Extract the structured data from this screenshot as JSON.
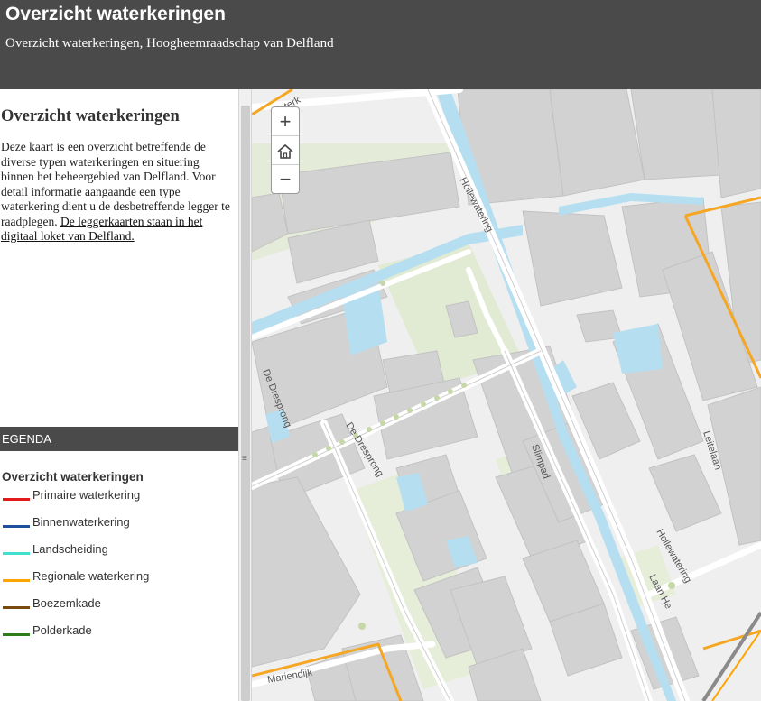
{
  "header": {
    "title": "Overzicht waterkeringen",
    "subtitle": "Overzicht waterkeringen, Hoogheemraadschap van Delfland"
  },
  "sidebar": {
    "heading": "Overzicht waterkeringen",
    "description": "Deze kaart is een overzicht betreffende de diverse typen waterkeringen en situering binnen het beheergebied van Delfland. Voor detail informatie aangaande een type waterkering dient u de desbetreffende legger te raadplegen.",
    "link_text": "De leggerkaarten staan in het digitaal loket van Delfland."
  },
  "legend": {
    "bar_label": "EGENDA",
    "title": "Overzicht waterkeringen",
    "items": [
      {
        "label": "Primaire waterkering",
        "color": "#e31a1c"
      },
      {
        "label": "Binnenwaterkering",
        "color": "#1f4e9c"
      },
      {
        "label": "Landscheiding",
        "color": "#40e0d0"
      },
      {
        "label": "Regionale waterkering",
        "color": "#ffa500"
      },
      {
        "label": "Boezemkade",
        "color": "#7a4a0e"
      },
      {
        "label": "Polderkade",
        "color": "#2e7d1a"
      }
    ]
  },
  "map": {
    "zoom_in": "+",
    "zoom_out": "−",
    "home_icon": "home-icon",
    "street_labels": {
      "hollewatering_1": "Hollewatering",
      "hollewatering_2": "Hollewatering",
      "de_dresprong_1": "De Dresprong",
      "de_dresprong_2": "De Dresprong",
      "slimpad": "Slimpad",
      "leitelaan": "Leitelaan",
      "laan_he": "Laan He",
      "waterkering_top": "Waterk",
      "mariendijk": "Mariendijk"
    }
  }
}
